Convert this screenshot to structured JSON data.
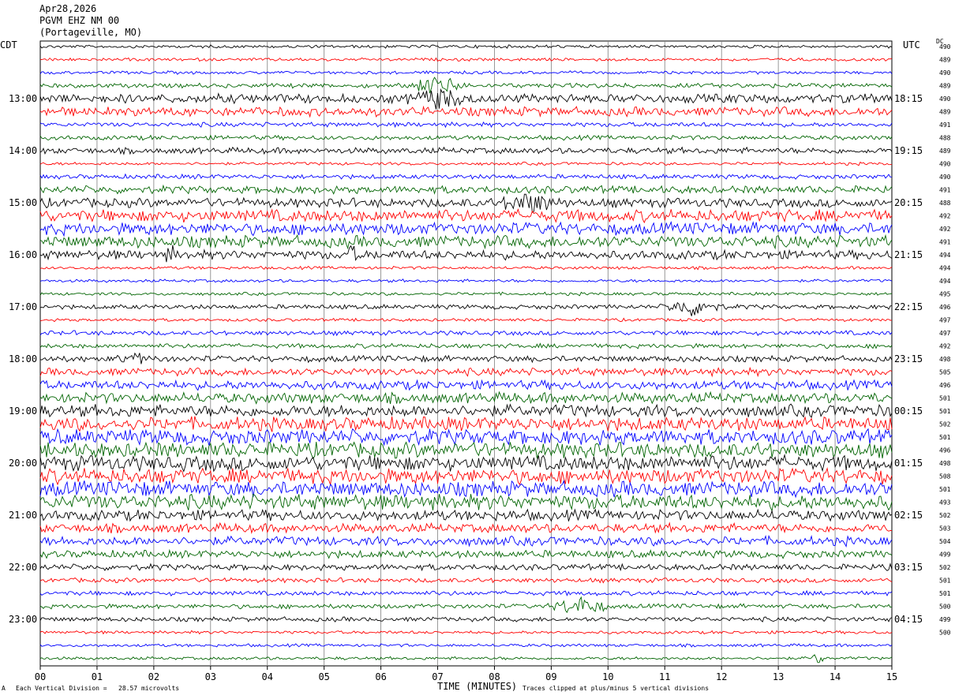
{
  "header": {
    "date": "Apr28,2026",
    "station": "PGVM EHZ NM 00",
    "location": "(Portageville, MO)"
  },
  "left_tz": "CDT",
  "right_tz": "UTC",
  "dc_label": "DC",
  "footer": {
    "scale": "Each Vertical Division =   28.57 microvolts",
    "xtitle": "TIME (MINUTES)",
    "clip": "Traces clipped at plus/minus 5 vertical divisions",
    "mark": "A"
  },
  "colors": {
    "black": "#000000",
    "red": "#ff0000",
    "blue": "#0000ff",
    "green": "#006400",
    "grid": "#808080"
  },
  "chart_data": {
    "type": "line",
    "title": "PGVM EHZ NM 00 (Portageville, MO) Apr28,2026",
    "xlabel": "TIME (MINUTES)",
    "x_ticks": [
      "00",
      "01",
      "02",
      "03",
      "04",
      "05",
      "06",
      "07",
      "08",
      "09",
      "10",
      "11",
      "12",
      "13",
      "14",
      "15"
    ],
    "xlim": [
      0,
      15
    ],
    "left_hour_labels": [
      "13:00",
      "14:00",
      "15:00",
      "16:00",
      "17:00",
      "18:00",
      "19:00",
      "20:00",
      "21:00",
      "22:00",
      "23:00"
    ],
    "right_hour_labels": [
      "18:15",
      "19:15",
      "20:15",
      "21:15",
      "22:15",
      "23:15",
      "00:15",
      "01:15",
      "02:15",
      "03:15",
      "04:15"
    ],
    "trace_colors": [
      "black",
      "red",
      "blue",
      "green"
    ],
    "dc_offsets": [
      490,
      489,
      490,
      489,
      490,
      489,
      491,
      488,
      489,
      490,
      490,
      491,
      488,
      492,
      492,
      491,
      494,
      494,
      494,
      495,
      496,
      497,
      497,
      492,
      498,
      505,
      496,
      501,
      501,
      502,
      501,
      496,
      498,
      508,
      501,
      493,
      502,
      503,
      504,
      499,
      502,
      501,
      501,
      500,
      499,
      500
    ],
    "trace_amplitude_level": [
      1,
      1,
      1,
      1.5,
      3,
      3,
      1.5,
      1.5,
      2,
      1,
      1.5,
      2.5,
      3,
      4,
      4,
      4,
      3,
      1,
      1,
      1,
      1.5,
      1,
      1.5,
      1.5,
      2,
      2.5,
      3,
      3.5,
      4,
      4.5,
      5,
      5,
      5,
      5,
      5,
      5,
      3.5,
      3,
      3,
      2.5,
      2,
      1.5,
      1.5,
      1.5,
      1.5,
      1,
      1
    ],
    "events": [
      {
        "trace": 3,
        "minute": 7.0,
        "label": "burst"
      },
      {
        "trace": 4,
        "minute": 7.0,
        "label": "burst"
      },
      {
        "trace": 12,
        "minute": 8.6,
        "label": "burst"
      },
      {
        "trace": 16,
        "minute": 2.3,
        "label": "spike"
      },
      {
        "trace": 16,
        "minute": 5.5,
        "label": "spike"
      },
      {
        "trace": 20,
        "minute": 11.5,
        "label": "burst"
      },
      {
        "trace": 24,
        "minute": 1.7,
        "label": "spikes"
      },
      {
        "trace": 43,
        "minute": 9.5,
        "label": "burst"
      },
      {
        "trace": 47,
        "minute": 13.7,
        "label": "spike"
      }
    ]
  }
}
